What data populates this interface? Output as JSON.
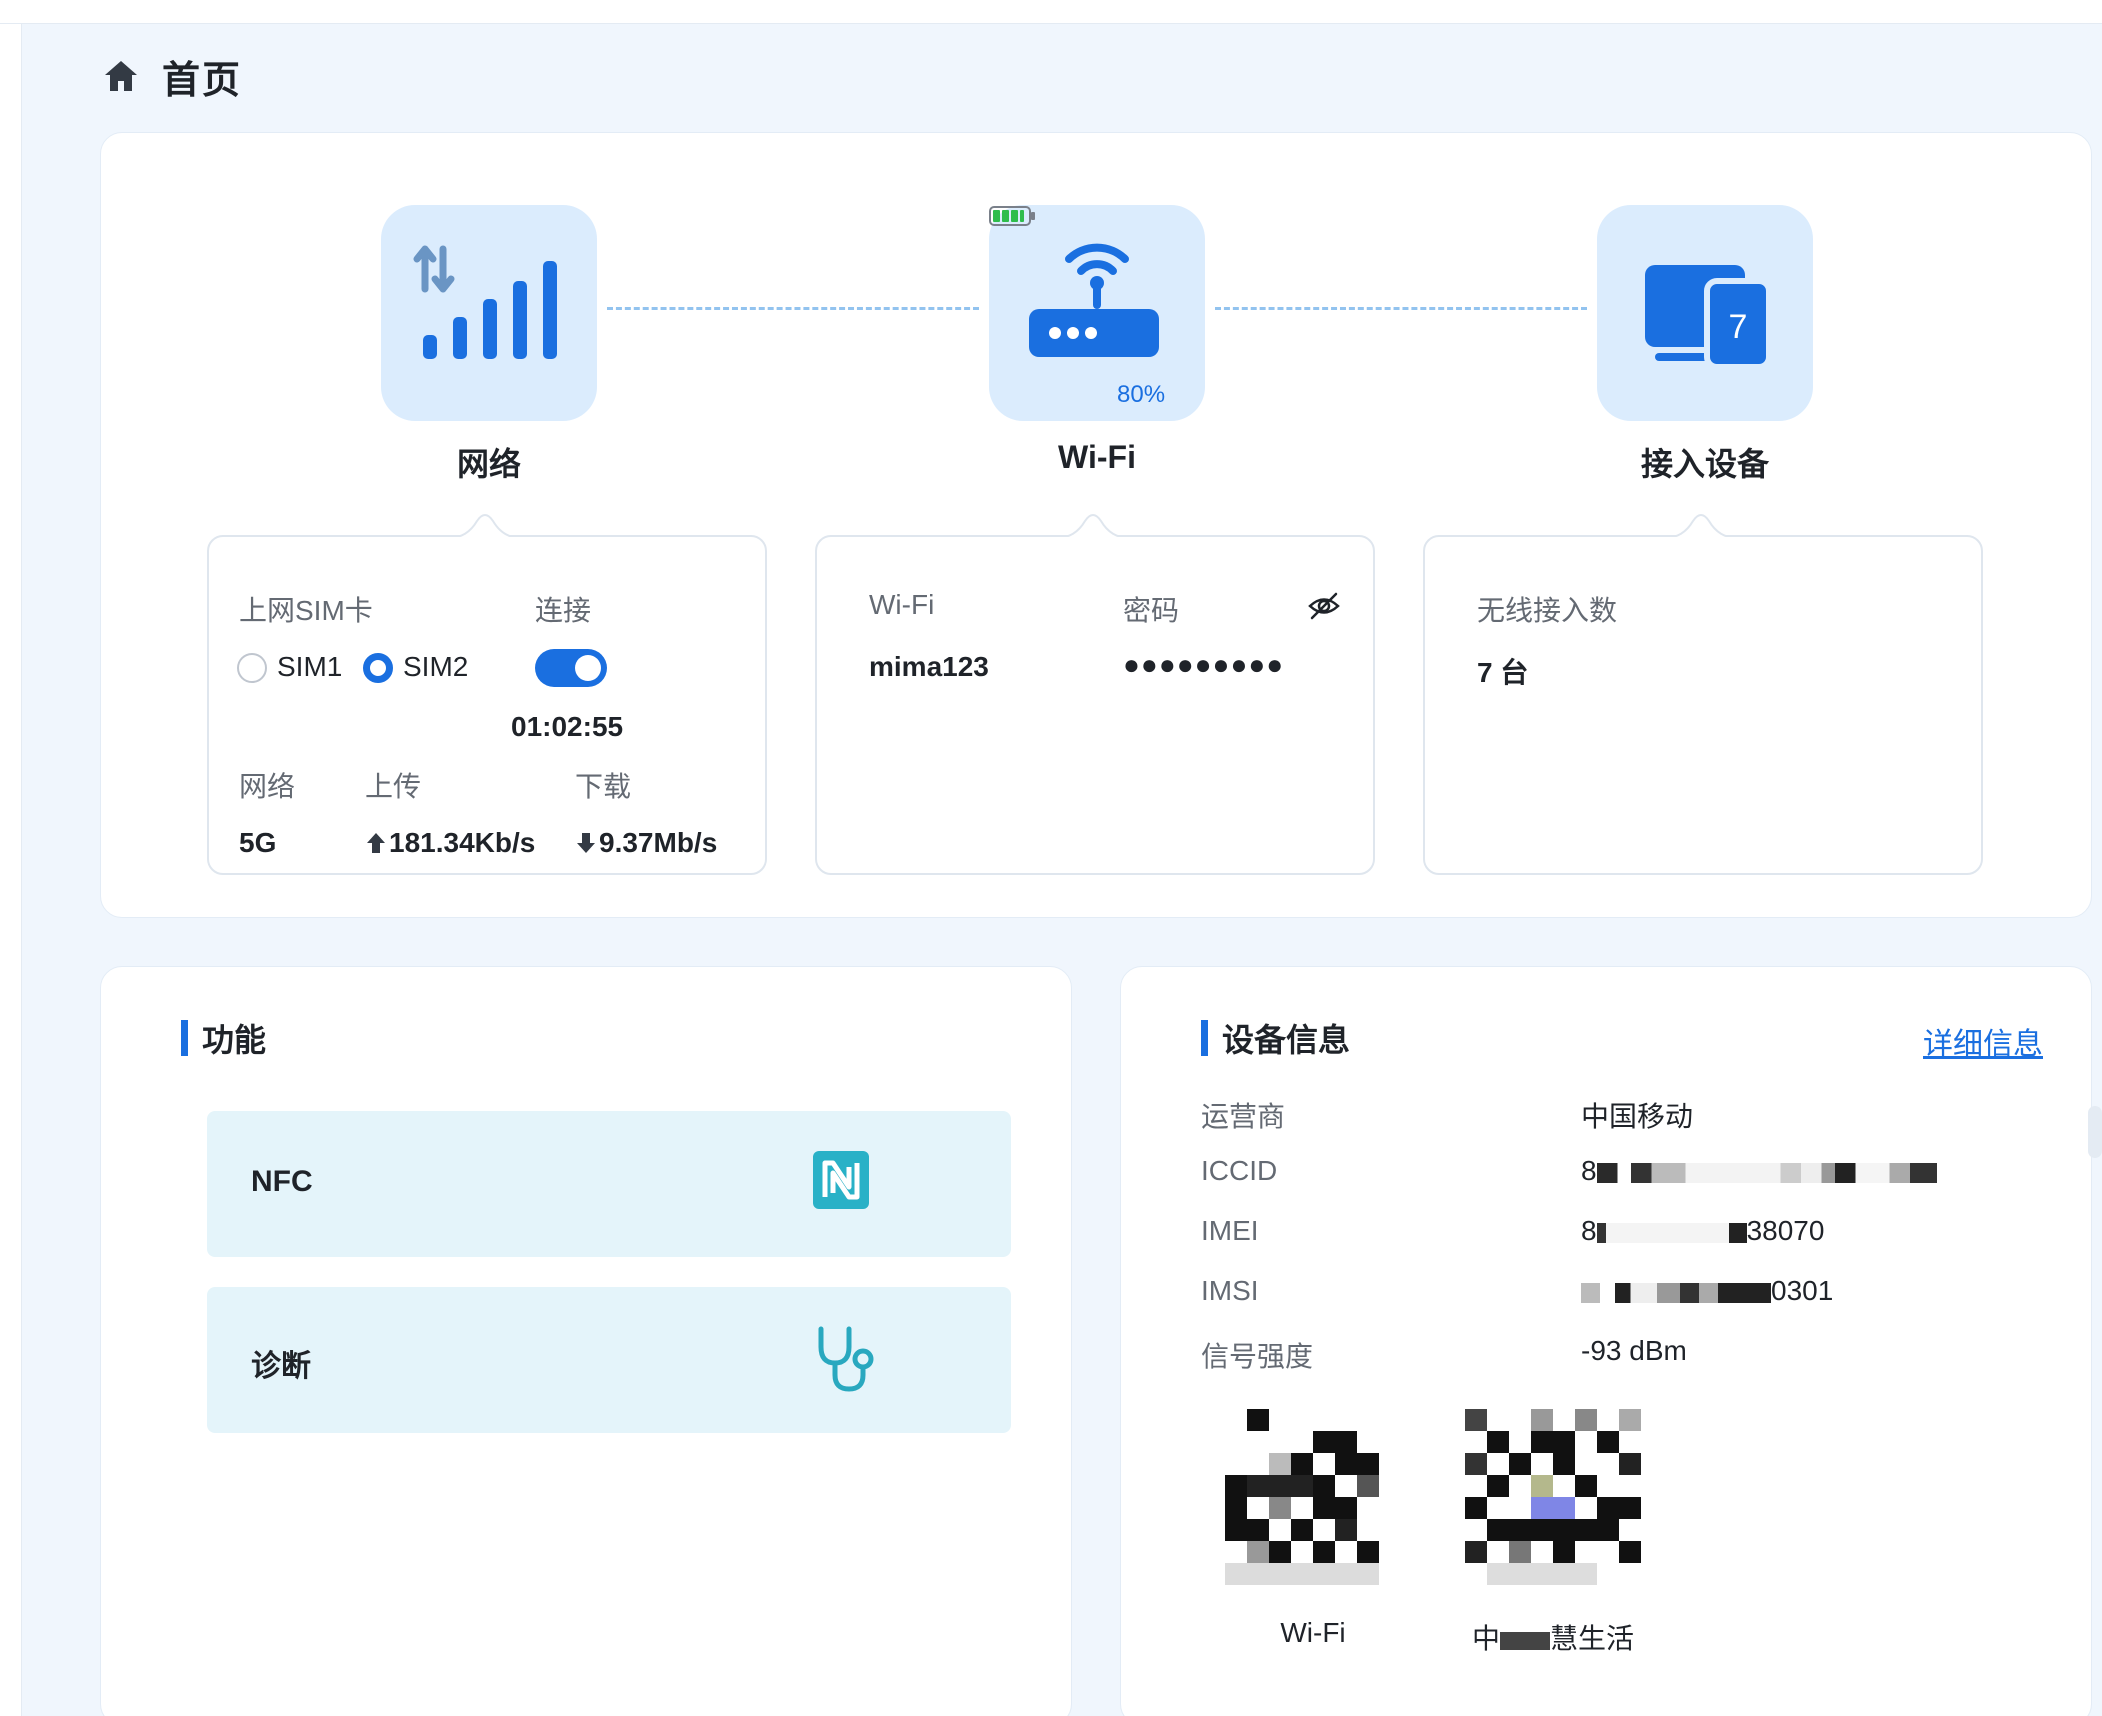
{
  "page": {
    "title": "首页"
  },
  "overview": {
    "network": {
      "label": "网络"
    },
    "wifi": {
      "label": "Wi-Fi",
      "battery_percent": "80%",
      "battery_level": 0.8
    },
    "devices": {
      "label": "接入设备",
      "count_badge": "7"
    }
  },
  "network_panel": {
    "sim_label": "上网SIM卡",
    "connect_label": "连接",
    "sim_options": [
      "SIM1",
      "SIM2"
    ],
    "sim_selected": "SIM2",
    "connected": true,
    "uptime": "01:02:55",
    "col_network": "网络",
    "col_upload": "上传",
    "col_download": "下载",
    "network_type": "5G",
    "upload_speed": "181.34Kb/s",
    "download_speed": "9.37Mb/s"
  },
  "wifi_panel": {
    "ssid_label": "Wi-Fi",
    "password_label": "密码",
    "ssid": "mima123",
    "password_masked": "●●●●●●●●●"
  },
  "devices_panel": {
    "wireless_label": "无线接入数",
    "wireless_count": "7 台"
  },
  "functions": {
    "title": "功能",
    "items": [
      {
        "label": "NFC",
        "icon": "nfc-icon"
      },
      {
        "label": "诊断",
        "icon": "stethoscope-icon"
      }
    ]
  },
  "device_info": {
    "title": "设备信息",
    "detail_link": "详细信息",
    "rows": [
      {
        "key": "运营商",
        "value": "中国移动"
      },
      {
        "key": "ICCID",
        "value": "8"
      },
      {
        "key": "IMEI",
        "value_prefix": "8",
        "value_suffix": "38070"
      },
      {
        "key": "IMSI",
        "value_suffix": "0301"
      },
      {
        "key": "信号强度",
        "value": "-93 dBm"
      }
    ],
    "qr_codes": [
      {
        "caption": "Wi-Fi"
      },
      {
        "caption_prefix": "中",
        "caption_suffix": "慧生活"
      }
    ]
  },
  "colors": {
    "accent": "#1a6fe0",
    "tile_bg": "#dbecfd",
    "func_bg": "#e4f4fa",
    "battery_green": "#2fbd4c"
  }
}
